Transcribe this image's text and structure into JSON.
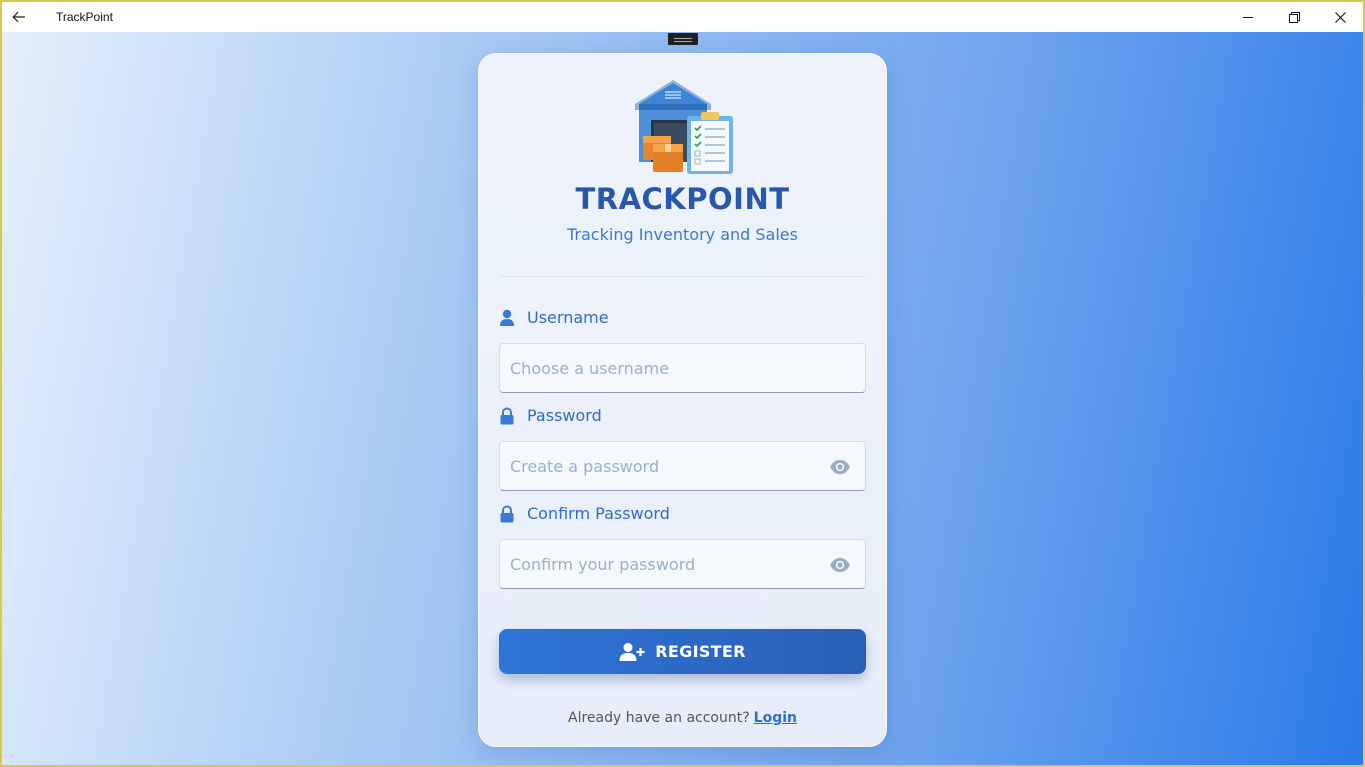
{
  "window": {
    "title": "TrackPoint"
  },
  "brand": {
    "name": "TRACKPOINT",
    "tagline": "Tracking Inventory and Sales"
  },
  "form": {
    "username": {
      "label": "Username",
      "placeholder": "Choose a username",
      "value": ""
    },
    "password": {
      "label": "Password",
      "placeholder": "Create a password",
      "value": ""
    },
    "confirm": {
      "label": "Confirm Password",
      "placeholder": "Confirm your password",
      "value": ""
    },
    "register_label": "REGISTER"
  },
  "footer": {
    "prompt": "Already have an account?",
    "link": "Login"
  },
  "colors": {
    "accent": "#2f6cc9",
    "brand": "#2858a8",
    "button": "#2e74d8"
  },
  "icons": [
    "back-arrow-icon",
    "minimize-icon",
    "restore-icon",
    "close-icon",
    "user-icon",
    "lock-icon",
    "eye-icon",
    "add-user-icon",
    "warehouse-logo-icon"
  ]
}
